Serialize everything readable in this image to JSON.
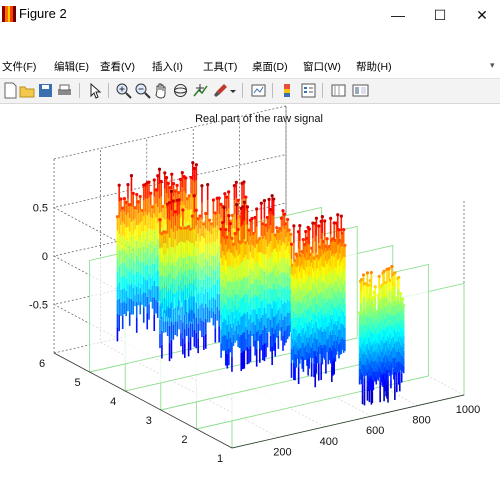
{
  "window": {
    "title": "Figure 2",
    "controls": [
      "—",
      "☐",
      "✕"
    ]
  },
  "menu": {
    "items": [
      "文件(F)",
      "编辑(E)",
      "查看(V)",
      "插入(I)",
      "工具(T)",
      "桌面(D)",
      "窗口(W)",
      "帮助(H)"
    ]
  },
  "toolbar": {
    "icons": [
      "new-figure-icon",
      "open-file-icon",
      "save-icon",
      "print-icon",
      "select-arrow-icon",
      "zoom-in-icon",
      "zoom-out-icon",
      "pan-hand-icon",
      "rotate-3d-icon",
      "data-cursor-icon",
      "brush-icon",
      "brush-dropdown-icon",
      "link-plot-icon",
      "insert-colorbar-icon",
      "insert-legend-icon",
      "hide-plot-tools-icon",
      "show-plot-tools-icon"
    ]
  },
  "chart_data": {
    "type": "3d-stem",
    "title": "Real part of the raw signal",
    "xlabel": "",
    "ylabel": "",
    "zlabel": "",
    "x_ticks": [
      200,
      400,
      600,
      800,
      1000
    ],
    "x_range": [
      0,
      1000
    ],
    "y_ticks": [
      1,
      2,
      3,
      4,
      5,
      6
    ],
    "y_range": [
      1,
      6
    ],
    "z_ticks": [
      -0.5,
      0,
      0.5
    ],
    "z_tick_labels": [
      "-0.5",
      "0",
      "0.5"
    ],
    "z_range": [
      -1,
      1
    ],
    "grid": true,
    "colormap": "jet",
    "series": [
      {
        "y": 1,
        "x_range": [
          550,
          740
        ],
        "z_min": -0.9,
        "z_max": 0.5
      },
      {
        "y": 2,
        "x_range": [
          410,
          640
        ],
        "z_min": -0.85,
        "z_max": 0.9
      },
      {
        "y": 3,
        "x_range": [
          260,
          560
        ],
        "z_min": -0.8,
        "z_max": 0.95
      },
      {
        "y": 4,
        "x_range": [
          150,
          520
        ],
        "z_min": -0.8,
        "z_max": 0.95
      },
      {
        "y": 5,
        "x_range": [
          120,
          460
        ],
        "z_min": -0.75,
        "z_max": 0.95
      }
    ]
  }
}
